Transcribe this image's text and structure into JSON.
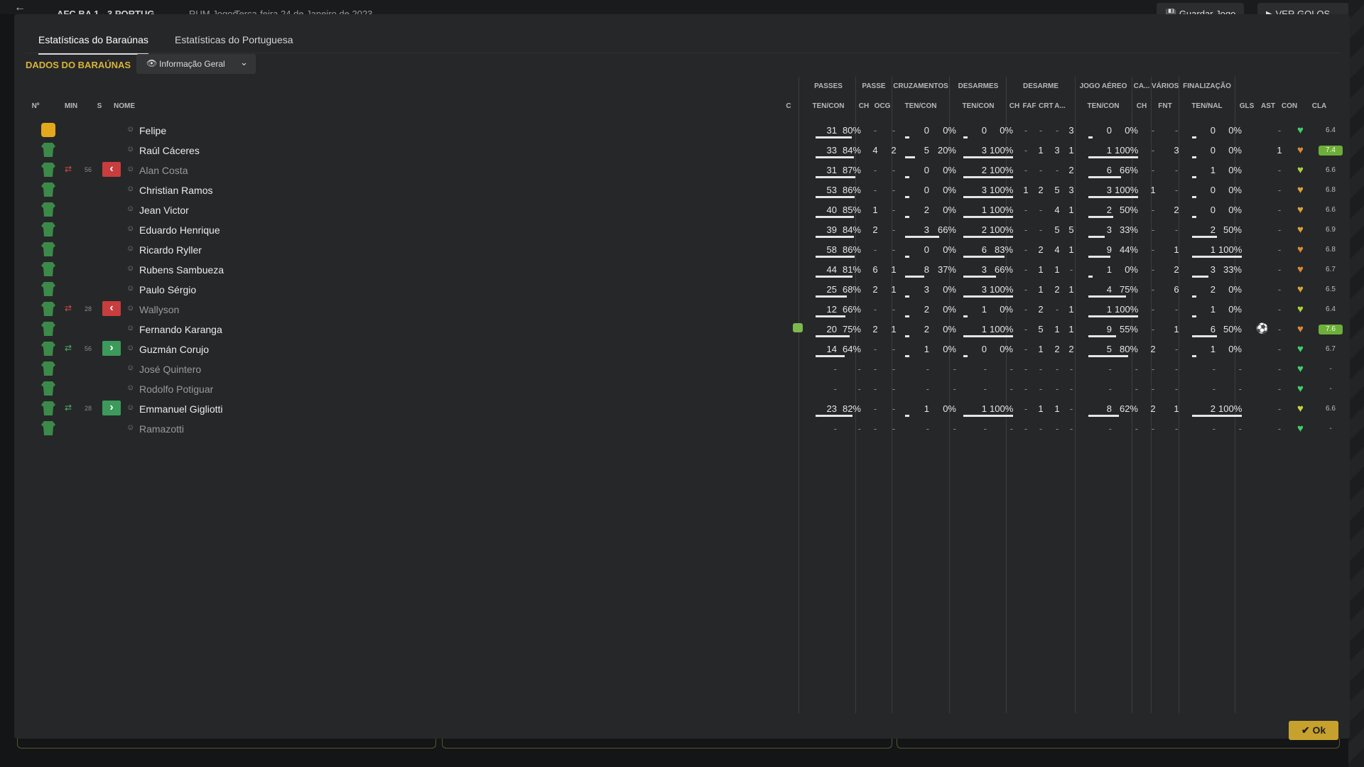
{
  "background": {
    "back_icon": "back-arrow-icon",
    "score": "AFC BA 1 - 3 PORTUG",
    "subtitle": "RUM Jogos",
    "date": "Terça-feira 24 de Janeiro de 2023",
    "save_label": "Guardar Jogo",
    "goals_label": "VER GOLOS"
  },
  "tabs": [
    {
      "label": "Estatísticas do Baraúnas",
      "active": true
    },
    {
      "label": "Estatísticas do Portuguesa",
      "active": false
    }
  ],
  "section_title": "DADOS DO BARAÚNAS",
  "view_select": {
    "value": "Informação Geral",
    "icon": "eye-icon"
  },
  "columns": {
    "groups": [
      "PASSES",
      "PASSE",
      "CRUZAMENTOS",
      "DESARMES",
      "DESARME",
      "JOGO AÉREO",
      "CA...",
      "VÁRIOS",
      "FINALIZAÇÃO"
    ],
    "headers": [
      "Nº",
      "MIN",
      "S",
      "NOME",
      "C",
      "TEN/CON",
      "CH",
      "OCG",
      "TEN/CON",
      "TEN/CON",
      "CH",
      "FAF",
      "CRT",
      "A...",
      "TEN/CON",
      "CH",
      "FNT",
      "TEN/NAL",
      "GLS",
      "AST",
      "CON",
      "CLA"
    ]
  },
  "players": [
    {
      "name": "Felipe",
      "kit": "gk",
      "dim": false,
      "sub": null,
      "min": "",
      "passes": {
        "ten": "31",
        "pct": "80%",
        "fill": 0.8
      },
      "pch": "-",
      "ocg": "-",
      "cruz": {
        "ten": "0",
        "pct": "0%",
        "fill": 0
      },
      "des": {
        "ten": "0",
        "pct": "0%",
        "fill": 0
      },
      "dch": "-",
      "faf": "-",
      "crt": "-",
      "a": "3",
      "aer": {
        "ten": "0",
        "pct": "0%",
        "fill": 0
      },
      "ca": "-",
      "fnt": "-",
      "fin": {
        "ten": "0",
        "pct": "0%",
        "fill": 0
      },
      "gls": "",
      "ast": "-",
      "heart": "#3fd06a",
      "cla": "6.4",
      "cla_good": false
    },
    {
      "name": "Raúl Cáceres",
      "kit": "field",
      "dim": false,
      "sub": null,
      "min": "",
      "passes": {
        "ten": "33",
        "pct": "84%",
        "fill": 0.84
      },
      "pch": "4",
      "ocg": "2",
      "cruz": {
        "ten": "5",
        "pct": "20%",
        "fill": 0.2
      },
      "des": {
        "ten": "3",
        "pct": "100%",
        "fill": 1
      },
      "dch": "-",
      "faf": "1",
      "crt": "3",
      "a": "1",
      "aer": {
        "ten": "1",
        "pct": "100%",
        "fill": 1
      },
      "ca": "-",
      "fnt": "3",
      "fin": {
        "ten": "0",
        "pct": "0%",
        "fill": 0
      },
      "gls": "",
      "ast": "1",
      "heart": "#d98a36",
      "cla": "7.4",
      "cla_good": true
    },
    {
      "name": "Alan Costa",
      "kit": "field",
      "dim": true,
      "sub": "out",
      "min": "56",
      "passes": {
        "ten": "31",
        "pct": "87%",
        "fill": 0.87
      },
      "pch": "-",
      "ocg": "-",
      "cruz": {
        "ten": "0",
        "pct": "0%",
        "fill": 0
      },
      "des": {
        "ten": "2",
        "pct": "100%",
        "fill": 1
      },
      "dch": "-",
      "faf": "-",
      "crt": "-",
      "a": "2",
      "aer": {
        "ten": "6",
        "pct": "66%",
        "fill": 0.66
      },
      "ca": "-",
      "fnt": "-",
      "fin": {
        "ten": "1",
        "pct": "0%",
        "fill": 0
      },
      "gls": "",
      "ast": "-",
      "heart": "#a8d23c",
      "cla": "6.6",
      "cla_good": false
    },
    {
      "name": "Christian Ramos",
      "kit": "field",
      "dim": false,
      "sub": null,
      "min": "",
      "passes": {
        "ten": "53",
        "pct": "86%",
        "fill": 0.86
      },
      "pch": "-",
      "ocg": "-",
      "cruz": {
        "ten": "0",
        "pct": "0%",
        "fill": 0
      },
      "des": {
        "ten": "3",
        "pct": "100%",
        "fill": 1
      },
      "dch": "1",
      "faf": "2",
      "crt": "5",
      "a": "3",
      "aer": {
        "ten": "3",
        "pct": "100%",
        "fill": 1
      },
      "ca": "1",
      "fnt": "-",
      "fin": {
        "ten": "0",
        "pct": "0%",
        "fill": 0
      },
      "gls": "",
      "ast": "-",
      "heart": "#d9a23a",
      "cla": "6.8",
      "cla_good": false
    },
    {
      "name": "Jean Victor",
      "kit": "field",
      "dim": false,
      "sub": null,
      "min": "",
      "passes": {
        "ten": "40",
        "pct": "85%",
        "fill": 0.85
      },
      "pch": "1",
      "ocg": "-",
      "cruz": {
        "ten": "2",
        "pct": "0%",
        "fill": 0
      },
      "des": {
        "ten": "1",
        "pct": "100%",
        "fill": 1
      },
      "dch": "-",
      "faf": "-",
      "crt": "4",
      "a": "1",
      "aer": {
        "ten": "2",
        "pct": "50%",
        "fill": 0.5
      },
      "ca": "-",
      "fnt": "2",
      "fin": {
        "ten": "0",
        "pct": "0%",
        "fill": 0
      },
      "gls": "",
      "ast": "-",
      "heart": "#d9a23a",
      "cla": "6.6",
      "cla_good": false
    },
    {
      "name": "Eduardo Henrique",
      "kit": "field",
      "dim": false,
      "sub": null,
      "min": "",
      "passes": {
        "ten": "39",
        "pct": "84%",
        "fill": 0.84
      },
      "pch": "2",
      "ocg": "-",
      "cruz": {
        "ten": "3",
        "pct": "66%",
        "fill": 0.66
      },
      "des": {
        "ten": "2",
        "pct": "100%",
        "fill": 1
      },
      "dch": "-",
      "faf": "-",
      "crt": "5",
      "a": "5",
      "aer": {
        "ten": "3",
        "pct": "33%",
        "fill": 0.33
      },
      "ca": "-",
      "fnt": "-",
      "fin": {
        "ten": "2",
        "pct": "50%",
        "fill": 0.5
      },
      "gls": "",
      "ast": "-",
      "heart": "#d9a23a",
      "cla": "6.9",
      "cla_good": false
    },
    {
      "name": "Ricardo Ryller",
      "kit": "field",
      "dim": false,
      "sub": null,
      "min": "",
      "passes": {
        "ten": "58",
        "pct": "86%",
        "fill": 0.86
      },
      "pch": "-",
      "ocg": "-",
      "cruz": {
        "ten": "0",
        "pct": "0%",
        "fill": 0
      },
      "des": {
        "ten": "6",
        "pct": "83%",
        "fill": 0.83
      },
      "dch": "-",
      "faf": "2",
      "crt": "4",
      "a": "1",
      "aer": {
        "ten": "9",
        "pct": "44%",
        "fill": 0.44
      },
      "ca": "-",
      "fnt": "1",
      "fin": {
        "ten": "1",
        "pct": "100%",
        "fill": 1
      },
      "gls": "",
      "ast": "-",
      "heart": "#d98a36",
      "cla": "6.8",
      "cla_good": false
    },
    {
      "name": "Rubens Sambueza",
      "kit": "field",
      "dim": false,
      "sub": null,
      "min": "",
      "passes": {
        "ten": "44",
        "pct": "81%",
        "fill": 0.81
      },
      "pch": "6",
      "ocg": "1",
      "cruz": {
        "ten": "8",
        "pct": "37%",
        "fill": 0.37
      },
      "des": {
        "ten": "3",
        "pct": "66%",
        "fill": 0.66
      },
      "dch": "-",
      "faf": "1",
      "crt": "1",
      "a": "-",
      "aer": {
        "ten": "1",
        "pct": "0%",
        "fill": 0
      },
      "ca": "-",
      "fnt": "2",
      "fin": {
        "ten": "3",
        "pct": "33%",
        "fill": 0.33
      },
      "gls": "",
      "ast": "-",
      "heart": "#d98a36",
      "cla": "6.7",
      "cla_good": false
    },
    {
      "name": "Paulo Sérgio",
      "kit": "field",
      "dim": false,
      "sub": null,
      "min": "",
      "passes": {
        "ten": "25",
        "pct": "68%",
        "fill": 0.68
      },
      "pch": "2",
      "ocg": "1",
      "cruz": {
        "ten": "3",
        "pct": "0%",
        "fill": 0
      },
      "des": {
        "ten": "3",
        "pct": "100%",
        "fill": 1
      },
      "dch": "-",
      "faf": "1",
      "crt": "2",
      "a": "1",
      "aer": {
        "ten": "4",
        "pct": "75%",
        "fill": 0.75
      },
      "ca": "-",
      "fnt": "6",
      "fin": {
        "ten": "2",
        "pct": "0%",
        "fill": 0
      },
      "gls": "",
      "ast": "-",
      "heart": "#d9a23a",
      "cla": "6.5",
      "cla_good": false
    },
    {
      "name": "Wallyson",
      "kit": "field",
      "dim": true,
      "sub": "out",
      "min": "28",
      "passes": {
        "ten": "12",
        "pct": "66%",
        "fill": 0.66
      },
      "pch": "-",
      "ocg": "-",
      "cruz": {
        "ten": "2",
        "pct": "0%",
        "fill": 0
      },
      "des": {
        "ten": "1",
        "pct": "0%",
        "fill": 0
      },
      "dch": "-",
      "faf": "2",
      "crt": "-",
      "a": "1",
      "aer": {
        "ten": "1",
        "pct": "100%",
        "fill": 1
      },
      "ca": "-",
      "fnt": "-",
      "fin": {
        "ten": "1",
        "pct": "0%",
        "fill": 0
      },
      "gls": "",
      "ast": "-",
      "heart": "#a8d23c",
      "cla": "6.4",
      "cla_good": false
    },
    {
      "name": "Fernando Karanga",
      "kit": "field",
      "dim": false,
      "sub": null,
      "min": "",
      "cup": true,
      "passes": {
        "ten": "20",
        "pct": "75%",
        "fill": 0.75
      },
      "pch": "2",
      "ocg": "1",
      "cruz": {
        "ten": "2",
        "pct": "0%",
        "fill": 0
      },
      "des": {
        "ten": "1",
        "pct": "100%",
        "fill": 1
      },
      "dch": "-",
      "faf": "5",
      "crt": "1",
      "a": "1",
      "aer": {
        "ten": "9",
        "pct": "55%",
        "fill": 0.55
      },
      "ca": "-",
      "fnt": "1",
      "fin": {
        "ten": "6",
        "pct": "50%",
        "fill": 0.5
      },
      "gls": "goal",
      "ast": "-",
      "heart": "#d98a36",
      "cla": "7.6",
      "cla_good": true
    },
    {
      "name": "Guzmán Corujo",
      "kit": "field",
      "dim": false,
      "sub": "in",
      "min": "56",
      "passes": {
        "ten": "14",
        "pct": "64%",
        "fill": 0.64
      },
      "pch": "-",
      "ocg": "-",
      "cruz": {
        "ten": "1",
        "pct": "0%",
        "fill": 0
      },
      "des": {
        "ten": "0",
        "pct": "0%",
        "fill": 0
      },
      "dch": "-",
      "faf": "1",
      "crt": "2",
      "a": "2",
      "aer": {
        "ten": "5",
        "pct": "80%",
        "fill": 0.8
      },
      "ca": "2",
      "fnt": "-",
      "fin": {
        "ten": "1",
        "pct": "0%",
        "fill": 0
      },
      "gls": "",
      "ast": "-",
      "heart": "#3fd06a",
      "cla": "6.7",
      "cla_good": false
    },
    {
      "name": "José Quintero",
      "kit": "field",
      "dim": true,
      "sub": null,
      "min": "",
      "passes": {
        "ten": "-",
        "pct": "-",
        "fill": 0
      },
      "pch": "-",
      "ocg": "-",
      "cruz": {
        "ten": "-",
        "pct": "-",
        "fill": 0
      },
      "des": {
        "ten": "-",
        "pct": "-",
        "fill": 0
      },
      "dch": "-",
      "faf": "-",
      "crt": "-",
      "a": "-",
      "aer": {
        "ten": "-",
        "pct": "-",
        "fill": 0
      },
      "ca": "-",
      "fnt": "-",
      "fin": {
        "ten": "-",
        "pct": "-",
        "fill": 0
      },
      "gls": "",
      "ast": "-",
      "heart": "#3fd06a",
      "cla": "-",
      "cla_good": false
    },
    {
      "name": "Rodolfo Potiguar",
      "kit": "field",
      "dim": true,
      "sub": null,
      "min": "",
      "passes": {
        "ten": "-",
        "pct": "-",
        "fill": 0
      },
      "pch": "-",
      "ocg": "-",
      "cruz": {
        "ten": "-",
        "pct": "-",
        "fill": 0
      },
      "des": {
        "ten": "-",
        "pct": "-",
        "fill": 0
      },
      "dch": "-",
      "faf": "-",
      "crt": "-",
      "a": "-",
      "aer": {
        "ten": "-",
        "pct": "-",
        "fill": 0
      },
      "ca": "-",
      "fnt": "-",
      "fin": {
        "ten": "-",
        "pct": "-",
        "fill": 0
      },
      "gls": "",
      "ast": "-",
      "heart": "#3fd06a",
      "cla": "-",
      "cla_good": false
    },
    {
      "name": "Emmanuel Gigliotti",
      "kit": "field",
      "dim": false,
      "sub": "in",
      "min": "28",
      "passes": {
        "ten": "23",
        "pct": "82%",
        "fill": 0.82
      },
      "pch": "-",
      "ocg": "-",
      "cruz": {
        "ten": "1",
        "pct": "0%",
        "fill": 0
      },
      "des": {
        "ten": "1",
        "pct": "100%",
        "fill": 1
      },
      "dch": "-",
      "faf": "1",
      "crt": "1",
      "a": "-",
      "aer": {
        "ten": "8",
        "pct": "62%",
        "fill": 0.62
      },
      "ca": "2",
      "fnt": "1",
      "fin": {
        "ten": "2",
        "pct": "100%",
        "fill": 1
      },
      "gls": "",
      "ast": "-",
      "heart": "#c9d23c",
      "cla": "6.6",
      "cla_good": false
    },
    {
      "name": "Ramazotti",
      "kit": "field",
      "dim": true,
      "sub": null,
      "min": "",
      "passes": {
        "ten": "-",
        "pct": "-",
        "fill": 0
      },
      "pch": "-",
      "ocg": "-",
      "cruz": {
        "ten": "-",
        "pct": "-",
        "fill": 0
      },
      "des": {
        "ten": "-",
        "pct": "-",
        "fill": 0
      },
      "dch": "-",
      "faf": "-",
      "crt": "-",
      "a": "-",
      "aer": {
        "ten": "-",
        "pct": "-",
        "fill": 0
      },
      "ca": "-",
      "fnt": "-",
      "fin": {
        "ten": "-",
        "pct": "-",
        "fill": 0
      },
      "gls": "",
      "ast": "-",
      "heart": "#3fd06a",
      "cla": "-",
      "cla_good": false
    }
  ],
  "ok_label": "Ok"
}
